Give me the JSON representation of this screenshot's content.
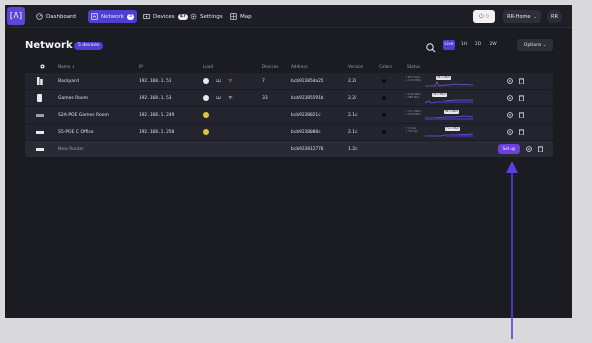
{
  "topbar": {
    "logo": "[Λ]",
    "nav": [
      {
        "label": "Dashboard",
        "icon": "dashboard-icon"
      },
      {
        "label": "Network",
        "icon": "network-icon",
        "badge": "5",
        "active": true
      },
      {
        "label": "Devices",
        "icon": "devices-icon",
        "badge": "47"
      },
      {
        "label": "Settings",
        "icon": "gear-icon"
      },
      {
        "label": "Map",
        "icon": "map-icon"
      }
    ],
    "alert_count": "0",
    "site_selector": "RR-Home",
    "user_initials": "RR"
  },
  "header": {
    "title": "Network",
    "badge": "5 devices",
    "ranges": [
      "Live",
      "1H",
      "2D",
      "2W"
    ],
    "active_range": "Live",
    "options_label": "Options"
  },
  "table": {
    "columns": {
      "name": "Name ↓",
      "ip": "IP",
      "load": "Load",
      "devices": "Devices",
      "address": "Address",
      "version": "Version",
      "colors": "Colors",
      "status": "Status"
    },
    "rows": [
      {
        "name": "Backyard",
        "icon": "router-icon",
        "ip": "192.168.1.51",
        "devices": "7",
        "address": "bcb92385da25",
        "version": "2.2i",
        "status_top": "↑ 87.5 kb/s",
        "status_bottom": "↓ 1.04 Mb/s",
        "status_tag": "58.1 Mb/s"
      },
      {
        "name": "Games Room",
        "icon": "router-icon",
        "ip": "192.168.1.53",
        "devices": "33",
        "address": "bcb92385591b",
        "version": "2.2i",
        "status_top": "↑ 3.45 Mb/s",
        "status_bottom": "↓ 380 Kb/s",
        "status_tag": "79.7 Mb/s"
      },
      {
        "name": "S2A-POE Games Room",
        "icon": "switch-icon",
        "ip": "192.168.1.249",
        "devices": "",
        "address": "bcb9238021c",
        "version": "2.1c",
        "status_top": "↑ 73.2 Mb/s",
        "status_bottom": "↓ 75.8 Mb/s",
        "status_tag": "58.1 Mb/s"
      },
      {
        "name": "S5-POE C Office",
        "icon": "switch-icon",
        "ip": "192.168.1.250",
        "devices": "",
        "address": "bcb9238088c",
        "version": "2.1c",
        "status_top": "↑ 2 Kb/s",
        "status_bottom": "↓ 372 b/s",
        "status_tag": "71.1 Mb/s"
      }
    ],
    "new_row": {
      "name": "New Router",
      "icon": "router-icon",
      "address": "bcb923812776",
      "version": "1.2c",
      "setup_label": "Set up"
    }
  },
  "colors": {
    "accent": "#4f3fd0",
    "arrow": "#5b3fe0",
    "bg": "#1b1b22"
  }
}
